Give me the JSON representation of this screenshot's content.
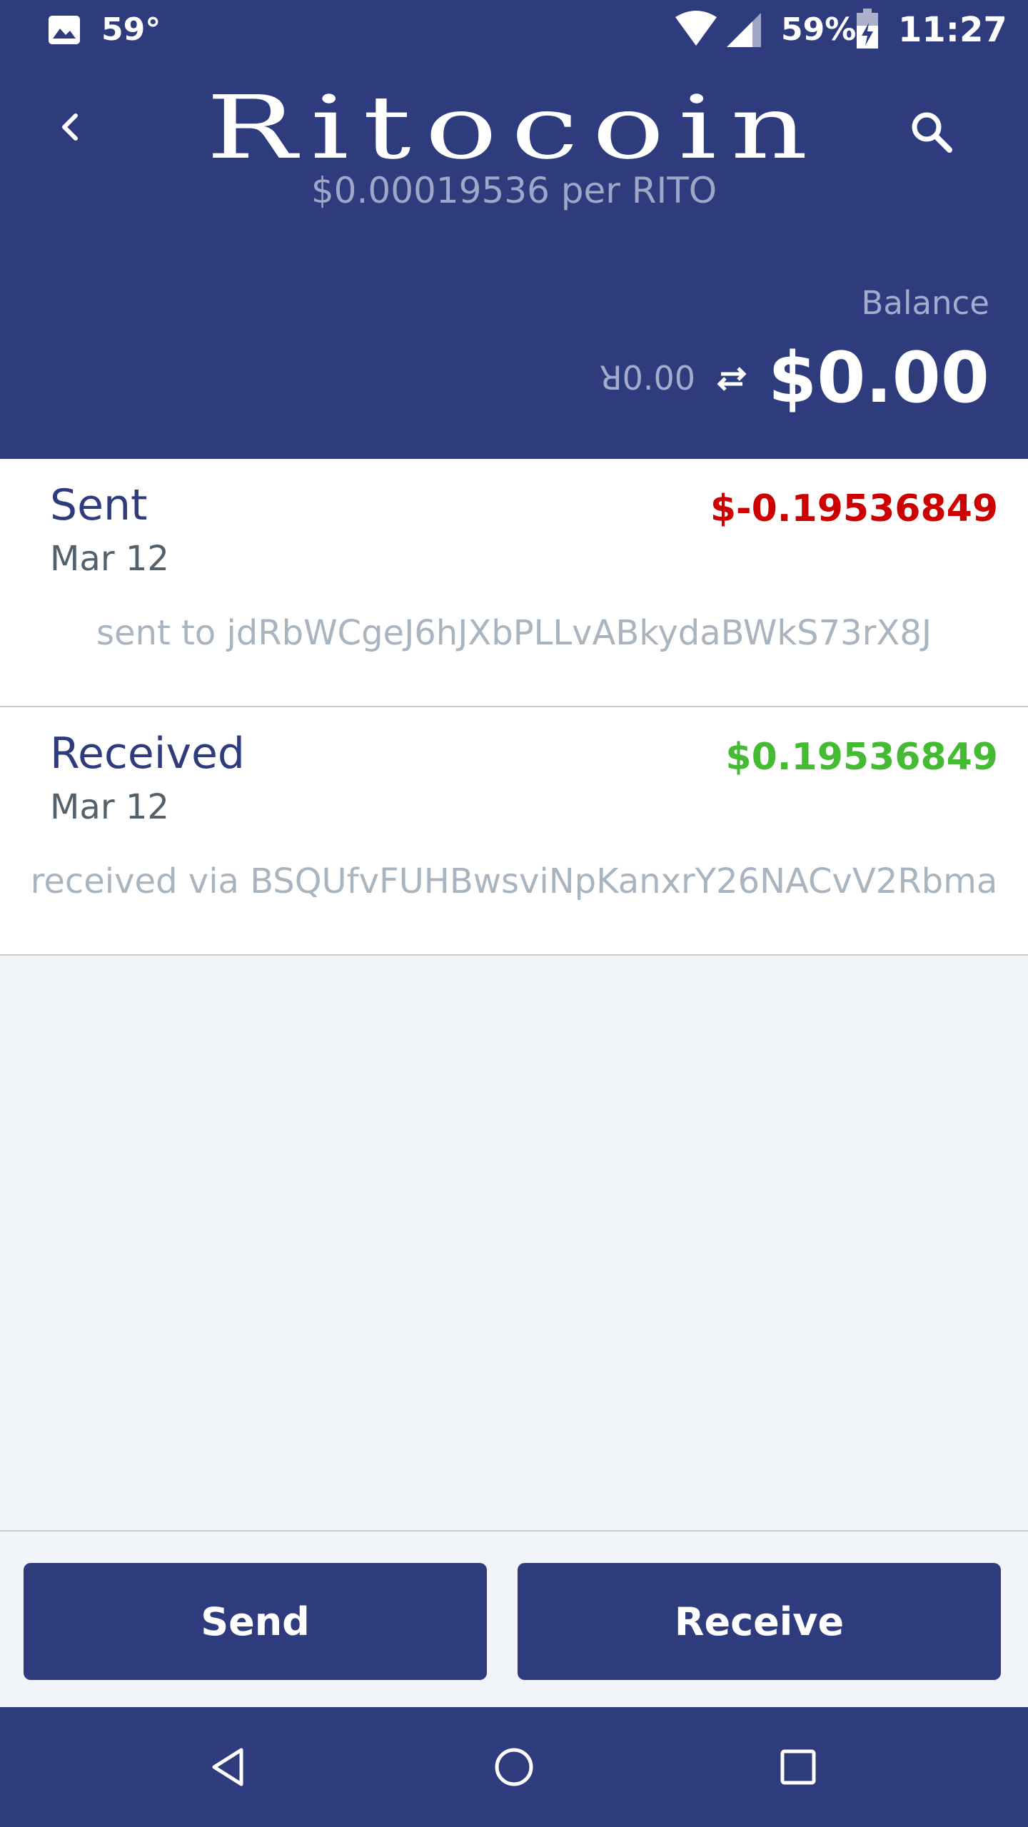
{
  "status_bar": {
    "temperature": "59°",
    "battery": "59%",
    "time": "11:27"
  },
  "header": {
    "title": "Ritocoin",
    "price_subtitle": "$0.00019536 per RITO",
    "balance_label": "Balance",
    "balance_alt": "ꓤ0.00",
    "balance_fiat": "$0.00"
  },
  "transactions": [
    {
      "type": "Sent",
      "date": "Mar 12",
      "amount": "$-0.19536849",
      "amount_color": "#cc0000",
      "note": "sent to jdRbWCgeJ6hJXbPLLvABkydaBWkS73rX8J"
    },
    {
      "type": "Received",
      "date": "Mar 12",
      "amount": "$0.19536849",
      "amount_color": "#44bb33",
      "note": "received via BSQUfvFUHBwsviNpKanxrY26NACvV2Rbma"
    }
  ],
  "actions": {
    "send_label": "Send",
    "receive_label": "Receive"
  },
  "icons": {
    "gallery": "image-icon",
    "wifi": "wifi-icon",
    "signal": "cell-signal-icon",
    "battery": "battery-charging-icon",
    "back": "back-arrow-icon",
    "search": "search-icon",
    "swap": "swap-icon",
    "nav_back": "nav-back-icon",
    "nav_home": "nav-home-icon",
    "nav_recents": "nav-recents-icon"
  },
  "colors": {
    "brand": "#2e3b7d",
    "negative": "#cc0000",
    "positive": "#44bb33",
    "background": "#f1f5f9"
  }
}
